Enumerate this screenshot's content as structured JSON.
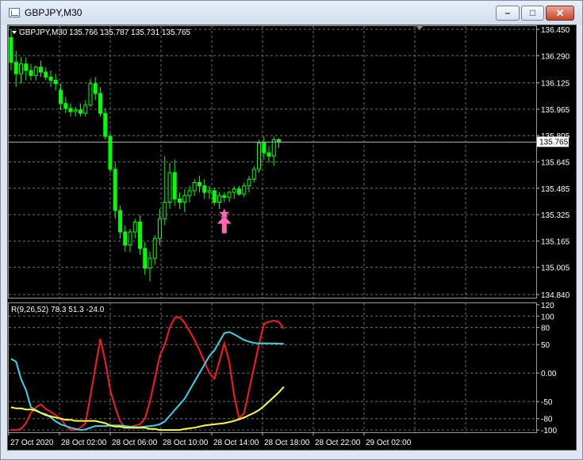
{
  "window": {
    "title": "GBPJPY,M30",
    "icon": "chart-window-icon",
    "buttons": {
      "minimize": "minimize-icon",
      "maximize": "maximize-icon",
      "close": "close-icon"
    }
  },
  "chart_data": [
    {
      "type": "candlestick",
      "header": "GBPJPY,M30  135.766 135.787 135.731 135.765",
      "y_ticks": [
        "136.450",
        "136.290",
        "136.125",
        "135.965",
        "135.805",
        "135.645",
        "135.485",
        "135.325",
        "135.165",
        "135.005",
        "134.840"
      ],
      "current_price": "135.765",
      "ylim": [
        134.84,
        136.45
      ],
      "grid": true,
      "colors": {
        "background": "#000000",
        "candle": "#00ff00",
        "grid": "#6e6e6e",
        "text": "#ffffff"
      },
      "markers": [
        {
          "type": "star",
          "color": "#ff66b3",
          "bar": 43,
          "price": 135.33
        },
        {
          "type": "up-arrow",
          "color": "#ff66b3",
          "bar": 43,
          "price": 135.26
        }
      ],
      "candles": [
        [
          136.4,
          136.45,
          136.2,
          136.25
        ],
        [
          136.25,
          136.32,
          136.1,
          136.18
        ],
        [
          136.18,
          136.28,
          136.12,
          136.24
        ],
        [
          136.24,
          136.28,
          136.14,
          136.2
        ],
        [
          136.2,
          136.24,
          136.14,
          136.17
        ],
        [
          136.17,
          136.23,
          136.14,
          136.22
        ],
        [
          136.22,
          136.26,
          136.16,
          136.19
        ],
        [
          136.19,
          136.22,
          136.14,
          136.16
        ],
        [
          136.16,
          136.2,
          136.1,
          136.14
        ],
        [
          136.14,
          136.18,
          136.08,
          136.12
        ],
        [
          136.08,
          136.12,
          135.96,
          136.0
        ],
        [
          136.0,
          136.04,
          135.94,
          135.97
        ],
        [
          135.97,
          136.0,
          135.92,
          135.95
        ],
        [
          135.95,
          135.98,
          135.92,
          135.96
        ],
        [
          135.96,
          136.0,
          135.92,
          135.94
        ],
        [
          135.94,
          136.02,
          135.92,
          135.99
        ],
        [
          135.99,
          136.15,
          135.98,
          136.12
        ],
        [
          136.12,
          136.16,
          136.02,
          136.06
        ],
        [
          136.06,
          136.1,
          135.92,
          135.94
        ],
        [
          135.94,
          135.97,
          135.78,
          135.8
        ],
        [
          135.8,
          135.82,
          135.58,
          135.6
        ],
        [
          135.6,
          135.64,
          135.3,
          135.35
        ],
        [
          135.35,
          135.38,
          135.18,
          135.22
        ],
        [
          135.22,
          135.26,
          135.1,
          135.14
        ],
        [
          135.14,
          135.24,
          135.1,
          135.22
        ],
        [
          135.22,
          135.3,
          135.18,
          135.28
        ],
        [
          135.28,
          135.32,
          135.08,
          135.12
        ],
        [
          135.12,
          135.16,
          134.96,
          135.0
        ],
        [
          135.0,
          135.1,
          134.92,
          135.06
        ],
        [
          135.06,
          135.2,
          135.02,
          135.18
        ],
        [
          135.18,
          135.36,
          135.14,
          135.3
        ],
        [
          135.3,
          135.68,
          135.26,
          135.4
        ],
        [
          135.4,
          135.64,
          135.36,
          135.58
        ],
        [
          135.58,
          135.66,
          135.38,
          135.42
        ],
        [
          135.42,
          135.46,
          135.36,
          135.4
        ],
        [
          135.4,
          135.48,
          135.34,
          135.44
        ],
        [
          135.44,
          135.5,
          135.4,
          135.47
        ],
        [
          135.47,
          135.54,
          135.44,
          135.52
        ],
        [
          135.52,
          135.56,
          135.46,
          135.5
        ],
        [
          135.5,
          135.54,
          135.42,
          135.46
        ],
        [
          135.46,
          135.5,
          135.42,
          135.47
        ],
        [
          135.47,
          135.49,
          135.38,
          135.4
        ],
        [
          135.4,
          135.46,
          135.36,
          135.44
        ],
        [
          135.44,
          135.46,
          135.4,
          135.43
        ],
        [
          135.43,
          135.47,
          135.4,
          135.46
        ],
        [
          135.46,
          135.5,
          135.42,
          135.48
        ],
        [
          135.48,
          135.5,
          135.44,
          135.45
        ],
        [
          135.45,
          135.52,
          135.43,
          135.5
        ],
        [
          135.5,
          135.56,
          135.46,
          135.54
        ],
        [
          135.54,
          135.62,
          135.52,
          135.6
        ],
        [
          135.6,
          135.78,
          135.58,
          135.76
        ],
        [
          135.76,
          135.8,
          135.66,
          135.7
        ],
        [
          135.7,
          135.74,
          135.64,
          135.68
        ],
        [
          135.68,
          135.8,
          135.62,
          135.78
        ],
        [
          135.78,
          135.79,
          135.73,
          135.765
        ]
      ]
    },
    {
      "type": "line",
      "header": "R(9,26,52) 78.3 51.3 -24.0",
      "y_ticks": [
        "120",
        "100",
        "80",
        "50",
        "0.00",
        "-50",
        "-80",
        "-100"
      ],
      "ylim": [
        -104,
        124
      ],
      "x_ticks": [
        "27 Oct 2020",
        "28 Oct 02:00",
        "28 Oct 06:00",
        "28 Oct 10:00",
        "28 Oct 14:00",
        "28 Oct 18:00",
        "28 Oct 22:00",
        "29 Oct 02:00"
      ],
      "series": [
        {
          "color": "#ff1a1a",
          "values": [
            -100,
            -100,
            -98,
            -88,
            -70,
            -60,
            -55,
            -63,
            -68,
            -74,
            -80,
            -92,
            -100,
            -100,
            -96,
            -88,
            -40,
            10,
            60,
            20,
            -30,
            -60,
            -85,
            -95,
            -95,
            -92,
            -90,
            -80,
            -50,
            -10,
            30,
            50,
            80,
            97,
            98,
            88,
            74,
            58,
            40,
            20,
            0,
            -10,
            20,
            52,
            20,
            -40,
            -80,
            -70,
            -30,
            10,
            50,
            86,
            90,
            92,
            90,
            78
          ]
        },
        {
          "color": "#33d6e8",
          "values": [
            25,
            20,
            -10,
            -30,
            -60,
            -65,
            -70,
            -72,
            -78,
            -85,
            -90,
            -93,
            -96,
            -98,
            -100,
            -99,
            -96,
            -93,
            -93,
            -93,
            -92,
            -92,
            -92,
            -93,
            -94,
            -95,
            -95,
            -94,
            -93,
            -92,
            -90,
            -85,
            -75,
            -65,
            -55,
            -45,
            -30,
            -15,
            0,
            15,
            30,
            40,
            55,
            70,
            72,
            68,
            63,
            58,
            55,
            53,
            52,
            52,
            52,
            52,
            51.5,
            51.3
          ]
        },
        {
          "color": "#ffff33",
          "values": [
            -60,
            -62,
            -62,
            -64,
            -64,
            -66,
            -70,
            -74,
            -76,
            -78,
            -80,
            -82,
            -82,
            -84,
            -84,
            -84,
            -84,
            -84,
            -86,
            -88,
            -92,
            -94,
            -94,
            -96,
            -96,
            -96,
            -96,
            -96,
            -98,
            -98,
            -100,
            -100,
            -100,
            -100,
            -100,
            -98,
            -97,
            -96,
            -94,
            -92,
            -91,
            -90,
            -89,
            -88,
            -86,
            -84,
            -81,
            -78,
            -74,
            -70,
            -65,
            -58,
            -50,
            -42,
            -34,
            -24
          ]
        }
      ]
    }
  ]
}
